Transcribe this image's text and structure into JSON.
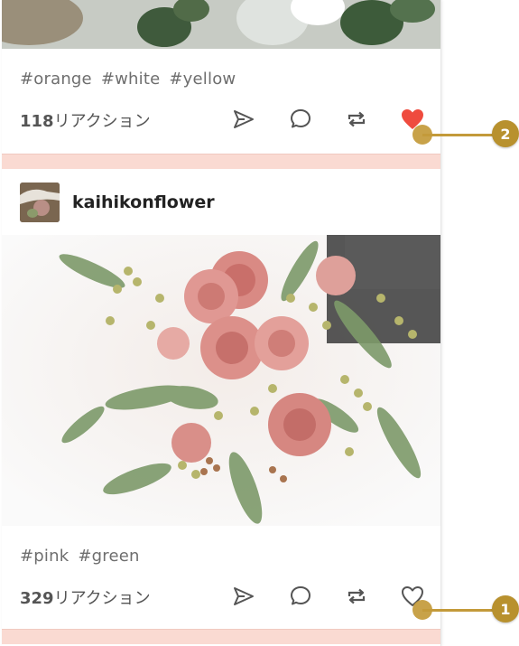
{
  "posts": [
    {
      "tags": [
        "#orange",
        "#white",
        "#yellow"
      ],
      "reaction_count": "118",
      "reaction_suffix": "リアクション",
      "liked": true
    },
    {
      "author": "kaihikonflower",
      "tags": [
        "#pink",
        "#green"
      ],
      "reaction_count": "329",
      "reaction_suffix": "リアクション",
      "liked": false
    }
  ],
  "callouts": [
    "1",
    "2"
  ],
  "colors": {
    "heart_liked": "#ef4b3e",
    "divider": "#fadad2",
    "callout": "#b8912e",
    "icon": "#555555"
  },
  "icons": [
    "send-icon",
    "comment-icon",
    "reblog-icon",
    "heart-icon"
  ]
}
